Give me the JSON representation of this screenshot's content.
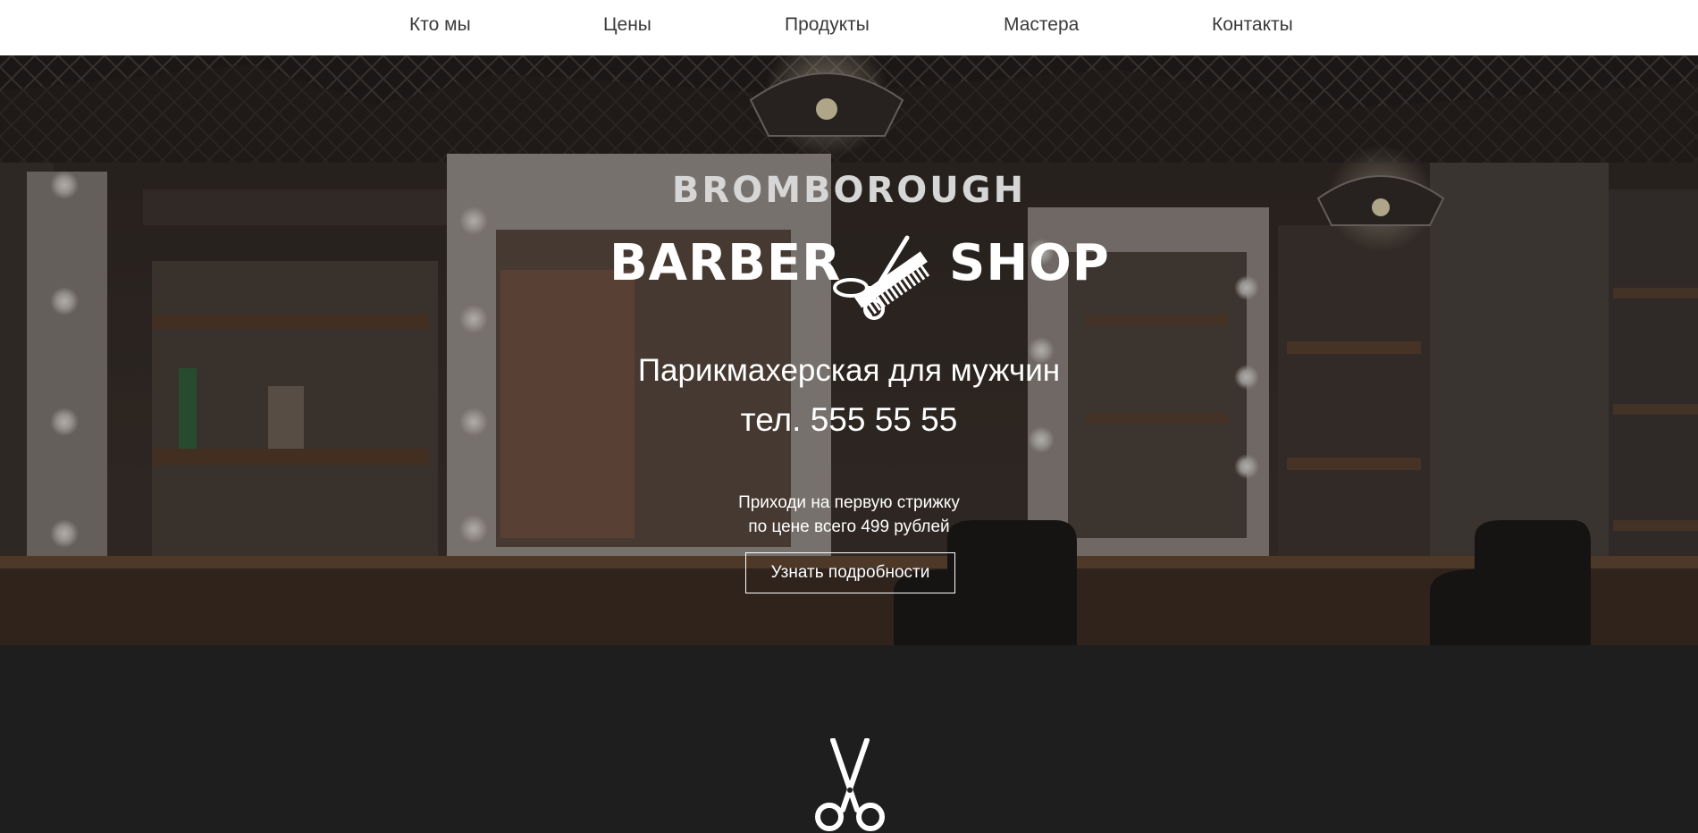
{
  "nav": {
    "items": [
      {
        "label": "Кто мы"
      },
      {
        "label": "Цены"
      },
      {
        "label": "Продукты"
      },
      {
        "label": "Мастера"
      },
      {
        "label": "Контакты"
      }
    ]
  },
  "hero": {
    "brand_top": "BROMBOROUGH",
    "brand_left": "BARBER",
    "brand_right": "SHOP",
    "logo_icon": "scissors-comb-icon",
    "tagline": "Парикмахерская для мужчин",
    "phone": "тел. 555 55 55",
    "promo_line1": "Приходи на первую стрижку",
    "promo_line2": "по цене всего 499 рублей",
    "button_label": "Узнать подробности"
  },
  "section": {
    "icon": "scissors-icon"
  },
  "colors": {
    "nav_bg": "#ffffff",
    "nav_text": "#3a3a3a",
    "hero_text": "#ffffff",
    "brand_top": "#d6d6d6",
    "dark_bg": "#1e1e1e"
  }
}
